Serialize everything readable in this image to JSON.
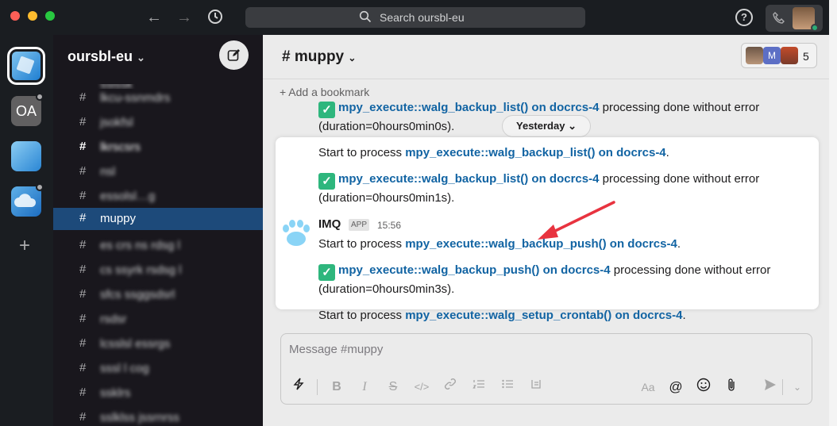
{
  "search": {
    "placeholder": "Search oursbl-eu"
  },
  "workspace": {
    "name": "oursbl-eu",
    "chevron": "⌄"
  },
  "rail": {
    "items": [
      {
        "label": ""
      },
      {
        "label": "OA"
      },
      {
        "label": ""
      },
      {
        "label": ""
      }
    ],
    "add_label": "+"
  },
  "channels": [
    {
      "label": "lkcu-ssnmdrs"
    },
    {
      "label": "jsokfsl"
    },
    {
      "label": "lkrscsrs"
    },
    {
      "label": "nsl"
    },
    {
      "label": "essolsl…g"
    },
    {
      "label": "muppy"
    },
    {
      "label": "es crs ns rdsg l"
    },
    {
      "label": "cs ssyrk rsdsg l"
    },
    {
      "label": "sfcs ssggsdsrl"
    },
    {
      "label": "rsdsr"
    },
    {
      "label": "lcsslsl essrgs"
    },
    {
      "label": "sssl l cog"
    },
    {
      "label": "ssklrs"
    },
    {
      "label": "sslklss jssrnrss"
    }
  ],
  "header": {
    "channel": "# muppy",
    "member_count": "5",
    "avatar_letter": "M",
    "bookmark": "+  Add a bookmark"
  },
  "date_divider": "Yesterday",
  "messages": {
    "top_link": "mpy_execute::walg_backup_list() on docrcs-4",
    "top_text": " processing done without error",
    "top_duration": "(duration=0hours0min0s).",
    "m1_prefix": "Start to process ",
    "m1_link": "mpy_execute::walg_backup_list() on docrcs-4",
    "m1_suffix": ".",
    "m2_link": "mpy_execute::walg_backup_list() on docrcs-4",
    "m2_text": " processing done without error",
    "m2_duration": "(duration=0hours0min1s).",
    "author": "IMQ",
    "app_badge": "APP",
    "time": "15:56",
    "m3_prefix": "Start to process ",
    "m3_link": "mpy_execute::walg_backup_push() on docrcs-4",
    "m3_suffix": ".",
    "m4_link": "mpy_execute::walg_backup_push() on docrcs-4",
    "m4_text": " processing done without error",
    "m4_duration": "(duration=0hours0min3s).",
    "m5_prefix": "Start to process ",
    "m5_link": "mpy_execute::walg_setup_crontab() on docrcs-4",
    "m5_suffix": "."
  },
  "composer": {
    "placeholder": "Message #muppy",
    "format_aa": "Aa"
  },
  "icons": {
    "check": "check-mark-icon",
    "annotation": "red-arrow-icon"
  },
  "colors": {
    "link": "#1264a3",
    "check": "#2eb67d",
    "selected": "#1d4a7a",
    "arrow": "#e8333f"
  }
}
